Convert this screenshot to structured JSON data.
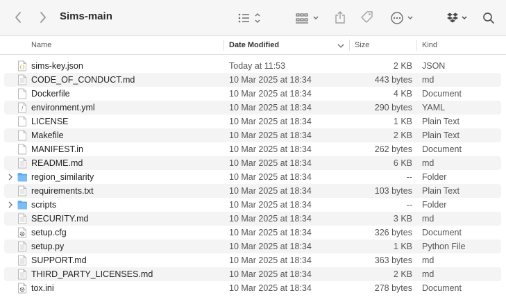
{
  "window": {
    "title": "Sims-main"
  },
  "toolbar": {
    "back_icon": "chevron-left-icon",
    "forward_icon": "chevron-right-icon",
    "view_icon": "list-view-icon",
    "group_icon": "grid-group-icon",
    "share_icon": "share-icon",
    "tag_icon": "tag-icon",
    "more_icon": "ellipsis-circle-icon",
    "dropbox_icon": "dropbox-icon",
    "search_icon": "search-icon"
  },
  "columns": {
    "name": "Name",
    "date_modified": "Date Modified",
    "size": "Size",
    "kind": "Kind"
  },
  "files": [
    {
      "name": "sims-key.json",
      "date": "Today at 11:53",
      "size": "2 KB",
      "kind": "JSON",
      "icon": "json-file-icon",
      "folder": false
    },
    {
      "name": "CODE_OF_CONDUCT.md",
      "date": "10 Mar 2025 at 18:34",
      "size": "443 bytes",
      "kind": "md",
      "icon": "text-file-icon",
      "folder": false
    },
    {
      "name": "Dockerfile",
      "date": "10 Mar 2025 at 18:34",
      "size": "4 KB",
      "kind": "Document",
      "icon": "blank-file-icon",
      "folder": false
    },
    {
      "name": "environment.yml",
      "date": "10 Mar 2025 at 18:34",
      "size": "290 bytes",
      "kind": "YAML",
      "icon": "yaml-file-icon",
      "folder": false
    },
    {
      "name": "LICENSE",
      "date": "10 Mar 2025 at 18:34",
      "size": "1 KB",
      "kind": "Plain Text",
      "icon": "blank-file-icon",
      "folder": false
    },
    {
      "name": "Makefile",
      "date": "10 Mar 2025 at 18:34",
      "size": "2 KB",
      "kind": "Plain Text",
      "icon": "blank-file-icon",
      "folder": false
    },
    {
      "name": "MANIFEST.in",
      "date": "10 Mar 2025 at 18:34",
      "size": "262 bytes",
      "kind": "Document",
      "icon": "blank-file-icon",
      "folder": false
    },
    {
      "name": "README.md",
      "date": "10 Mar 2025 at 18:34",
      "size": "6 KB",
      "kind": "md",
      "icon": "text-file-icon",
      "folder": false
    },
    {
      "name": "region_similarity",
      "date": "10 Mar 2025 at 18:34",
      "size": "--",
      "kind": "Folder",
      "icon": "folder-icon",
      "folder": true
    },
    {
      "name": "requirements.txt",
      "date": "10 Mar 2025 at 18:34",
      "size": "103 bytes",
      "kind": "Plain Text",
      "icon": "text-file-icon",
      "folder": false
    },
    {
      "name": "scripts",
      "date": "10 Mar 2025 at 18:34",
      "size": "--",
      "kind": "Folder",
      "icon": "folder-icon",
      "folder": true
    },
    {
      "name": "SECURITY.md",
      "date": "10 Mar 2025 at 18:34",
      "size": "3 KB",
      "kind": "md",
      "icon": "text-file-icon",
      "folder": false
    },
    {
      "name": "setup.cfg",
      "date": "10 Mar 2025 at 18:34",
      "size": "326 bytes",
      "kind": "Document",
      "icon": "gear-file-icon",
      "folder": false
    },
    {
      "name": "setup.py",
      "date": "10 Mar 2025 at 18:34",
      "size": "1 KB",
      "kind": "Python File",
      "icon": "text-file-icon",
      "folder": false
    },
    {
      "name": "SUPPORT.md",
      "date": "10 Mar 2025 at 18:34",
      "size": "363 bytes",
      "kind": "md",
      "icon": "text-file-icon",
      "folder": false
    },
    {
      "name": "THIRD_PARTY_LICENSES.md",
      "date": "10 Mar 2025 at 18:34",
      "size": "2 KB",
      "kind": "md",
      "icon": "text-file-icon",
      "folder": false
    },
    {
      "name": "tox.ini",
      "date": "10 Mar 2025 at 18:34",
      "size": "278 bytes",
      "kind": "Document",
      "icon": "gear-file-icon",
      "folder": false
    }
  ],
  "colors": {
    "folder": "#5aabf0",
    "toolbar_bg": "#f6f6f6",
    "alt_row": "#f4f4f5"
  }
}
